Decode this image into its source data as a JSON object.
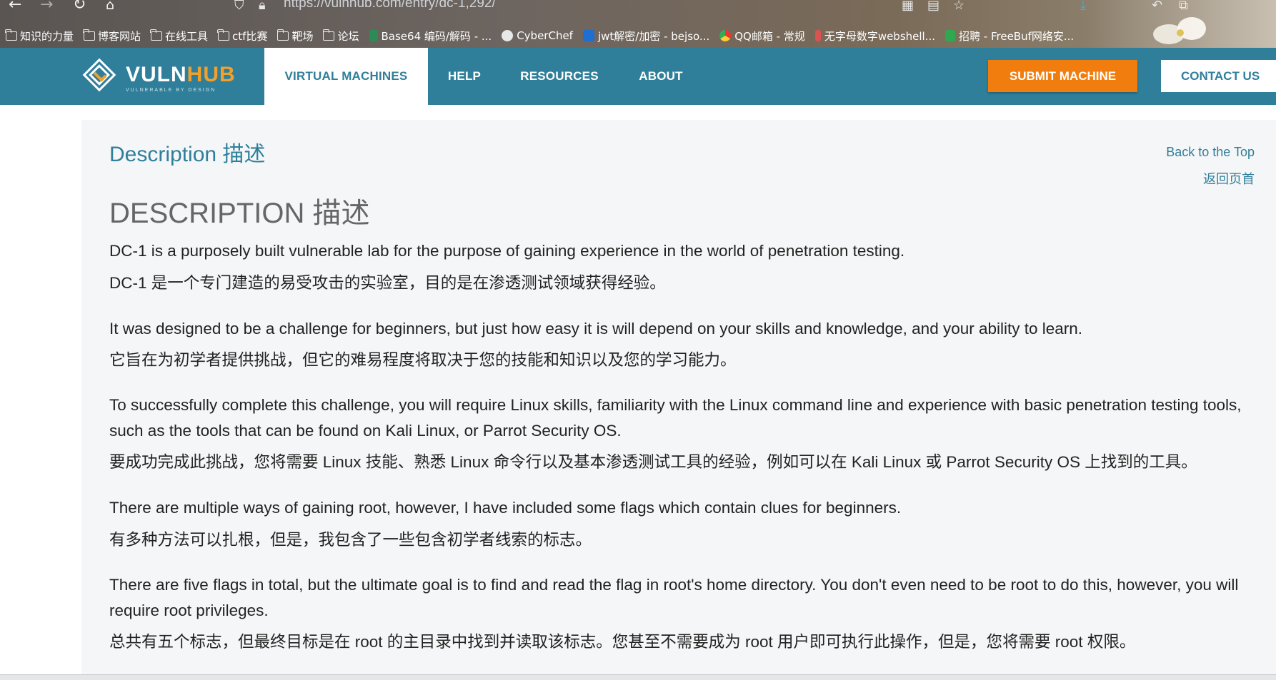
{
  "browser": {
    "url": "https://vulnhub.com/entry/dc-1,292/",
    "bookmarks": [
      {
        "label": "知识的力量",
        "icon": "folder-icon"
      },
      {
        "label": "博客网站",
        "icon": "folder-icon"
      },
      {
        "label": "在线工具",
        "icon": "folder-icon"
      },
      {
        "label": "ctf比赛",
        "icon": "folder-icon"
      },
      {
        "label": "靶场",
        "icon": "folder-icon"
      },
      {
        "label": "论坛",
        "icon": "folder-icon"
      },
      {
        "label": "Base64 编码/解码 - ...",
        "icon": "favicon"
      },
      {
        "label": "CyberChef",
        "icon": "favicon"
      },
      {
        "label": "jwt解密/加密 - bejso...",
        "icon": "favicon"
      },
      {
        "label": "QQ邮箱 - 常规",
        "icon": "favicon"
      },
      {
        "label": "无字母数字webshell...",
        "icon": "favicon"
      },
      {
        "label": "招聘 - FreeBuf网络安...",
        "icon": "favicon"
      }
    ]
  },
  "header": {
    "logo_main": "VULN",
    "logo_accent": "HUB",
    "logo_tagline": "VULNERABLE BY DESIGN",
    "nav": [
      {
        "label": "VIRTUAL MACHINES",
        "active": true
      },
      {
        "label": "HELP",
        "active": false
      },
      {
        "label": "RESOURCES",
        "active": false
      },
      {
        "label": "ABOUT",
        "active": false
      }
    ],
    "submit_label": "SUBMIT MACHINE",
    "contact_label": "CONTACT US",
    "colors": {
      "bar": "#2f7f9a",
      "accent": "#f07d0d"
    }
  },
  "content": {
    "section_title": "Description 描述",
    "back_to_top": "Back to the Top",
    "back_to_top_cn": "返回页首",
    "heading": "DESCRIPTION 描述",
    "paragraphs": [
      "DC-1 is a purposely built vulnerable lab for the purpose of gaining experience in the world of penetration testing.",
      "DC-1 是一个专门建造的易受攻击的实验室，目的是在渗透测试领域获得经验。",
      "It was designed to be a challenge for beginners, but just how easy it is will depend on your skills and knowledge, and your ability to learn.",
      "它旨在为初学者提供挑战，但它的难易程度将取决于您的技能和知识以及您的学习能力。",
      "To successfully complete this challenge, you will require Linux skills, familiarity with the Linux command line and experience with basic penetration testing tools, such as the tools that can be found on Kali Linux, or Parrot Security OS.",
      "要成功完成此挑战，您将需要 Linux 技能、熟悉 Linux 命令行以及基本渗透测试工具的经验，例如可以在 Kali Linux 或 Parrot Security OS 上找到的工具。",
      "There are multiple ways of gaining root, however, I have included some flags which contain clues for beginners.",
      "有多种方法可以扎根，但是，我包含了一些包含初学者线索的标志。",
      "There are five flags in total, but the ultimate goal is to find and read the flag in root's home directory. You don't even need to be root to do this, however, you will require root privileges.",
      "总共有五个标志，但最终目标是在 root 的主目录中找到并读取该标志。您甚至不需要成为 root 用户即可执行此操作，但是，您将需要 root 权限。"
    ]
  }
}
